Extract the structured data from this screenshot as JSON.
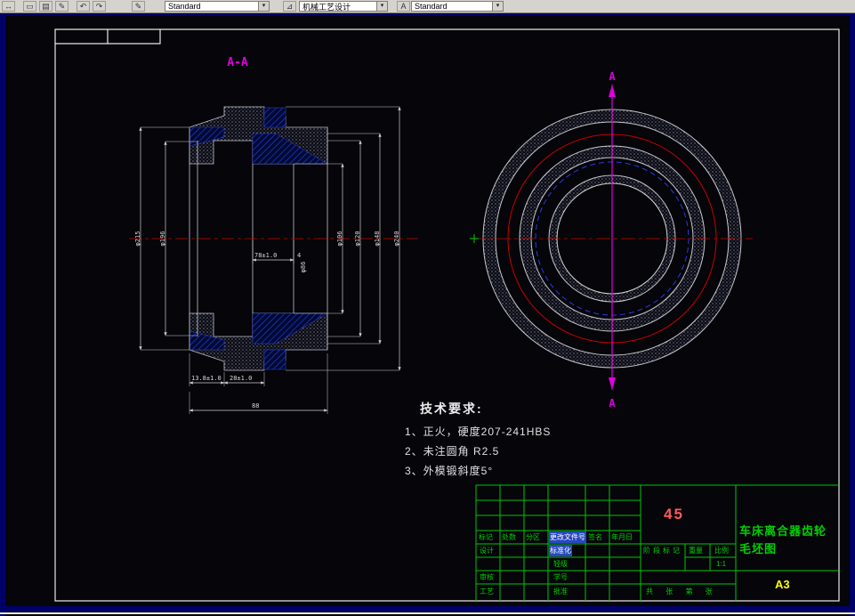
{
  "toolbar": {
    "combo_arrow": "▾",
    "icons": [
      {
        "name": "pan-icon",
        "glyph": "↔"
      },
      {
        "name": "new-icon",
        "glyph": "▭"
      },
      {
        "name": "open-icon",
        "glyph": "▤"
      },
      {
        "name": "pencil-icon",
        "glyph": "✎"
      },
      {
        "name": "undo-icon",
        "glyph": "↶"
      },
      {
        "name": "redo-icon",
        "glyph": "↷"
      },
      {
        "name": "edit-icon",
        "glyph": "✎"
      },
      {
        "name": "dim-style-icon",
        "glyph": "⊿"
      },
      {
        "name": "text-style-icon",
        "glyph": "A"
      }
    ],
    "dropdowns": [
      {
        "name": "dimension-style",
        "value": "Standard"
      },
      {
        "name": "process-style",
        "value": "机械工艺设计"
      },
      {
        "name": "text-style",
        "value": "Standard"
      }
    ]
  },
  "drawing": {
    "section_view_label": "A-A",
    "section_marker_top": "A",
    "section_marker_bottom": "A",
    "tech_requirements": {
      "title": "技术要求:",
      "items": [
        "1、正火，硬度207-241HBS",
        "2、未注圆角 R2.5",
        "3、外模锻斜度5°"
      ]
    },
    "dimensions": {
      "hub_width": "78±1.0",
      "step_width": "4",
      "flange_width": "13.8±1.0",
      "rim_width": "28±1.0",
      "overall_width": "88",
      "left_outer_dia": "φ215",
      "left_inner_dia": "φ196",
      "bore_dia": "φ86",
      "right_dia_1": "φ106",
      "right_dia_2": "φ120",
      "right_dia_3": "φ148",
      "right_outer_dia": "φ240"
    }
  },
  "title_block": {
    "material": "45",
    "drawing_title_line1": "车床离合器齿轮",
    "drawing_title_line2": "毛坯图",
    "sheet_size": "A3",
    "scale_value": "1:1",
    "revision_headers": [
      "标记",
      "处数",
      "分区",
      "更改文件号",
      "签名",
      "年月日"
    ],
    "cells": {
      "design": "设计",
      "standardization": "标准化",
      "grade": "轻级",
      "audit": "审核",
      "student_id": "学号",
      "process": "工艺",
      "approve": "批准",
      "stage_mark": "阶段标记",
      "weight": "重量",
      "scale": "比例",
      "sheets": "共 张 第 张"
    }
  },
  "colors": {
    "grid_green": "#00c800",
    "material_red": "#ff5a5a",
    "sheet_yellow": "#ffff00",
    "section_magenta": "#e000e0",
    "centerline_red": "#c80000",
    "hatch_blue": "#2a3ae0",
    "highlight_blue": "#2848c0"
  }
}
